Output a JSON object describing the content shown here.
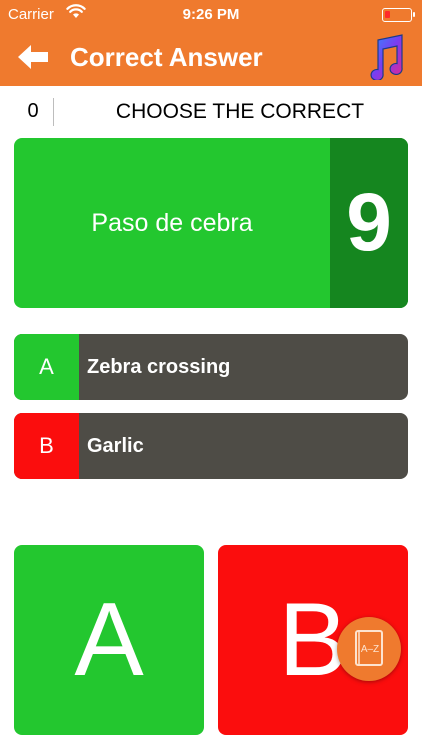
{
  "status_bar": {
    "carrier": "Carrier",
    "time": "9:26 PM"
  },
  "header": {
    "title": "Correct Answer",
    "back_icon": "arrow-left-icon",
    "music_icon": "music-notes-icon"
  },
  "quiz": {
    "score": "0",
    "instruction": "CHOOSE THE CORRECT",
    "word": "Paso de cebra",
    "timer": "9"
  },
  "options": [
    {
      "letter": "A",
      "text": "Zebra crossing",
      "color": "#23c72f"
    },
    {
      "letter": "B",
      "text": "Garlic",
      "color": "#fb0d0d"
    }
  ],
  "answer_buttons": [
    {
      "label": "A",
      "color": "#23c72f"
    },
    {
      "label": "B",
      "color": "#fb0d0d"
    }
  ],
  "dictionary_button": {
    "label": "A–Z",
    "icon": "dictionary-book-icon"
  },
  "colors": {
    "header": "#ef7a2e",
    "timer_bg": "#15861f",
    "option_bg": "#4e4c46"
  }
}
